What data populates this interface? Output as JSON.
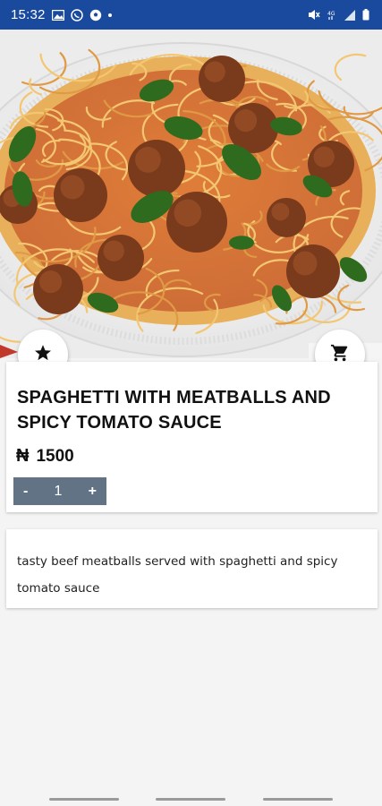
{
  "status_bar": {
    "time": "15:32",
    "left_icons": [
      "gallery-icon",
      "whatsapp-icon",
      "soccer-ball-icon",
      "notification-dot-icon"
    ],
    "right_icons": [
      "mute-icon",
      "signal-4g-icon",
      "signal-bars-icon",
      "battery-icon"
    ]
  },
  "hero": {
    "alt": "spaghetti-with-meatballs-photo"
  },
  "actions": {
    "favorite_icon": "star-icon",
    "cart_icon": "cart-icon"
  },
  "product": {
    "title": "SPAGHETTI WITH MEATBALLS AND SPICY TOMATO SAUCE",
    "currency_symbol": "₦",
    "price": "1500",
    "quantity": {
      "minus_label": "-",
      "value": "1",
      "plus_label": "+"
    }
  },
  "description": {
    "text": "tasty beef meatballs served with spaghetti and spicy tomato sauce"
  },
  "colors": {
    "status_bar": "#1a4a9e",
    "qty_bg": "#637386",
    "background": "#f4f4f4"
  }
}
